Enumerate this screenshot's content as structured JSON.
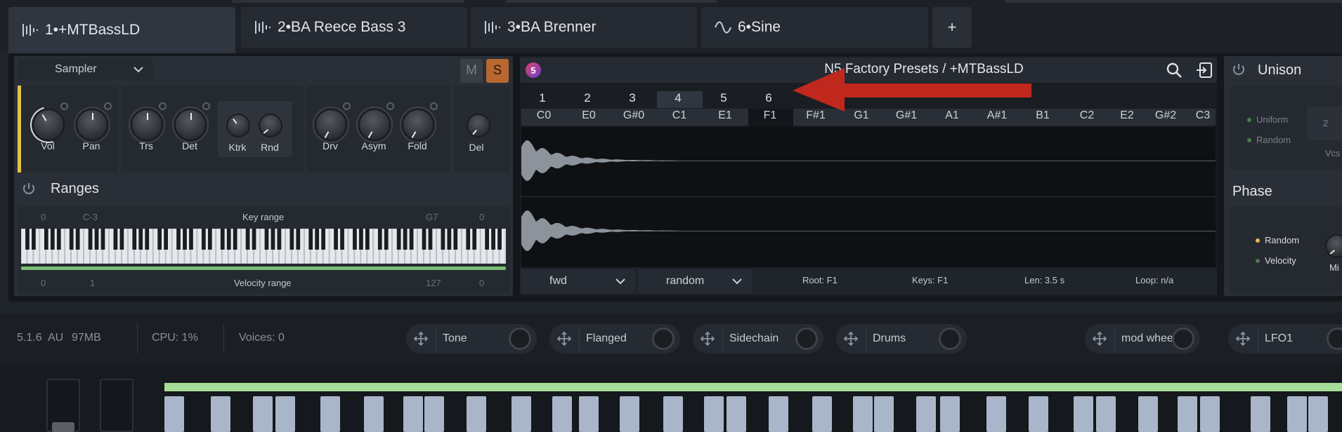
{
  "tabs": [
    {
      "label": "1•+MTBassLD",
      "icon": "waveform-icon"
    },
    {
      "label": "2•BA Reece Bass 3",
      "icon": "waveform-icon"
    },
    {
      "label": "3•BA Brenner",
      "icon": "waveform-icon"
    },
    {
      "label": "6•Sine",
      "icon": "sine-icon"
    }
  ],
  "add_tab": "+",
  "engine": {
    "selected": "Sampler"
  },
  "mute": "M",
  "solo": "S",
  "knobs": {
    "vol": "Vol",
    "pan": "Pan",
    "trs": "Trs",
    "det": "Det",
    "ktrk": "Ktrk",
    "rnd": "Rnd",
    "drv": "Drv",
    "asym": "Asym",
    "fold": "Fold",
    "del": "Del"
  },
  "ranges": {
    "title": "Ranges",
    "key_range_label": "Key range",
    "key_low_vel": "0",
    "key_low": "C-3",
    "key_high": "G7",
    "key_high_vel": "0",
    "velocity_range_label": "Velocity range",
    "vel_a": "0",
    "vel_b": "1",
    "vel_c": "127",
    "vel_d": "0"
  },
  "preset": {
    "badge": "5",
    "title": "N5 Factory Presets / +MTBassLD"
  },
  "layers": [
    "1",
    "2",
    "3",
    "4",
    "5",
    "6"
  ],
  "notes": [
    "C0",
    "E0",
    "G#0",
    "C1",
    "E1",
    "F1",
    "F#1",
    "G1",
    "G#1",
    "A1",
    "A#1",
    "B1",
    "C2",
    "E2",
    "G#2",
    "C3"
  ],
  "playback": {
    "direction": "fwd",
    "mode": "random"
  },
  "sample_info": {
    "root": "Root: F1",
    "keys": "Keys: F1",
    "len": "Len: 3.5 s",
    "loop": "Loop: n/a"
  },
  "unison": {
    "title": "Unison",
    "uniform": "Uniform",
    "random": "Random",
    "voices_value": "2",
    "voices_label": "Vcs"
  },
  "phase": {
    "title": "Phase",
    "random": "Random",
    "velocity": "Velocity",
    "knob_label": "Mi"
  },
  "status": {
    "version": "5.1.6",
    "format": "AU",
    "memory": "97MB",
    "cpu": "CPU: 1%",
    "voices": "Voices: 0"
  },
  "macros": [
    {
      "label": "Tone"
    },
    {
      "label": "Flanged"
    },
    {
      "label": "Sidechain"
    },
    {
      "label": "Drums"
    },
    {
      "label": "mod wheel"
    },
    {
      "label": "LFO1"
    }
  ],
  "colors": {
    "accent_yellow": "#e6c24b",
    "solo": "#b8672f",
    "arrow": "#c0281d",
    "keyboard_green": "#a6dd98"
  }
}
